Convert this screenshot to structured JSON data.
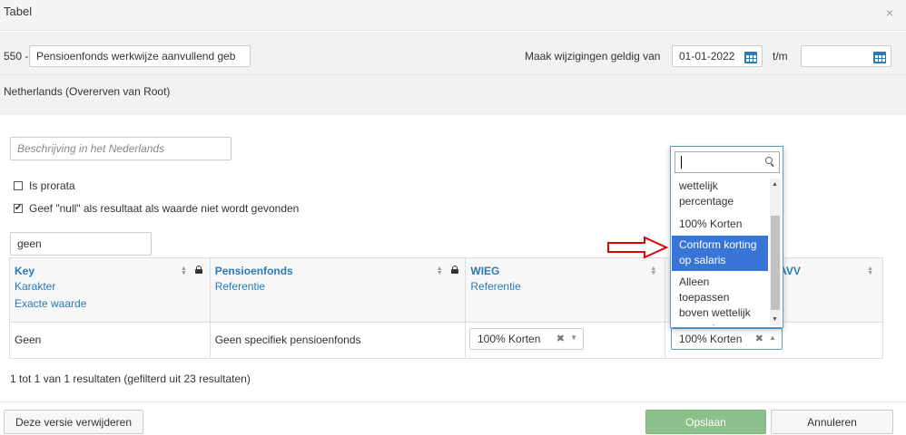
{
  "dialog": {
    "title": "Tabel",
    "close_symbol": "×"
  },
  "record": {
    "code": "550 -",
    "name_value": "Pensioenfonds werkwijze aanvullend geb",
    "valid_from_label": "Maak wijzigingen geldig van",
    "valid_from_value": "01-01-2022",
    "valid_to_label": "t/m",
    "valid_to_value": ""
  },
  "inheritance": {
    "text": "Netherlands (Overerven van Root)"
  },
  "description": {
    "placeholder": "Beschrijving in het Nederlands"
  },
  "options": {
    "prorata_label": "Is prorata",
    "prorata_checked": false,
    "null_label": "Geef \"null\" als resultaat als waarde niet wordt gevonden",
    "null_checked": true,
    "check_mark": "✔"
  },
  "filter": {
    "value": "geen"
  },
  "table": {
    "columns": [
      {
        "title": "Key",
        "sub": [
          "Karakter",
          "Exacte waarde"
        ]
      },
      {
        "title": "Pensioenfonds",
        "sub": [
          "Referentie"
        ]
      },
      {
        "title": "WIEG",
        "sub": [
          "Referentie"
        ]
      },
      {
        "title": "AVV",
        "sub": []
      }
    ],
    "rows": [
      {
        "key": "Geen",
        "pensioenfonds": "Geen specifiek pensioenfonds",
        "wieg": "100% Korten",
        "avv": "100% Korten"
      }
    ]
  },
  "dropdown": {
    "search_value": "",
    "items": [
      "wettelijk percentage",
      "100% Korten",
      "Conform korting op salaris",
      "Alleen toepassen boven wettelijk percentage"
    ],
    "highlighted": "Conform korting op salaris"
  },
  "pager": {
    "text": "1 tot 1 van 1 resultaten (gefilterd uit 23 resultaten)"
  },
  "footer": {
    "delete_label": "Deze versie verwijderen",
    "save_label": "Opslaan",
    "cancel_label": "Annuleren"
  },
  "colors": {
    "accent": "#2a7ab8",
    "highlight": "#3875d7",
    "save_green": "#8cc08a",
    "arrow_red": "#e00000"
  },
  "icons": {
    "close": "close-icon",
    "calendar": "calendar-icon",
    "lock": "lock-icon",
    "sort": "sort-icon",
    "search": "search-icon",
    "clear": "clear-icon",
    "arrow": "arrow-right-icon"
  }
}
